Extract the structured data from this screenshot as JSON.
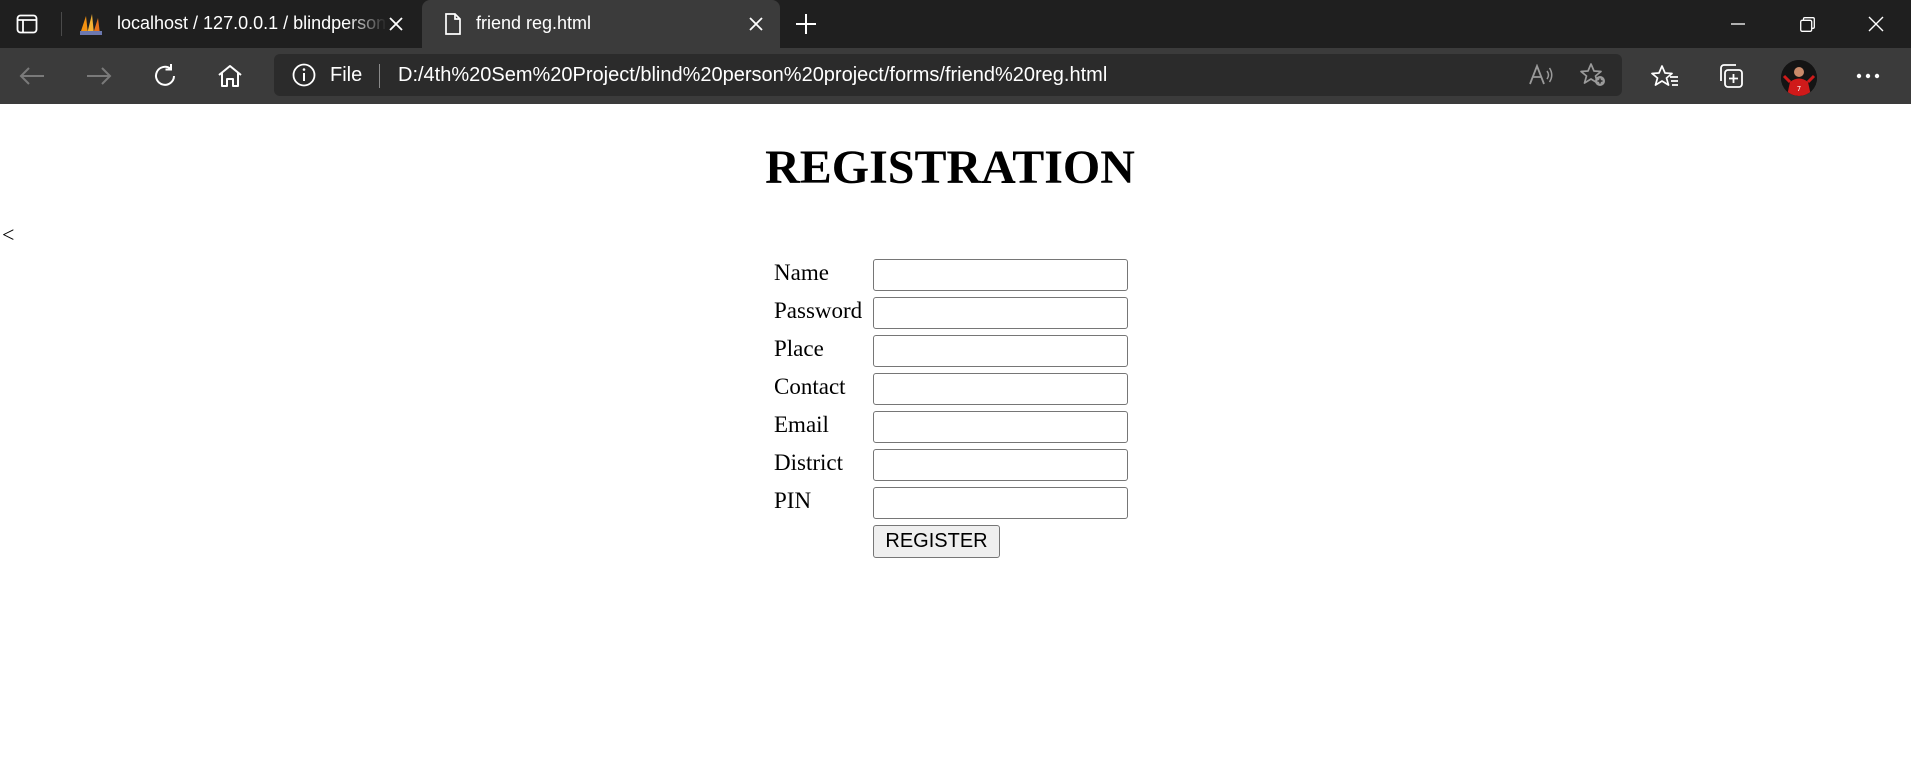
{
  "browser": {
    "tabs": [
      {
        "title": "localhost / 127.0.0.1 / blindperson",
        "favicon": "phpmyadmin-icon",
        "active": false
      },
      {
        "title": "friend reg.html",
        "favicon": "file-icon",
        "active": true
      }
    ],
    "address_bar": {
      "site_label": "File",
      "url": "D:/4th%20Sem%20Project/blind%20person%20project/forms/friend%20reg.html"
    },
    "colors": {
      "tabstrip": "#1f1f1f",
      "toolbar": "#3b3b3b",
      "omnibox": "#2b2b2b"
    }
  },
  "page": {
    "heading": "REGISTRATION",
    "stray_text": "<",
    "form": {
      "fields": [
        {
          "label": "Name",
          "value": ""
        },
        {
          "label": "Password",
          "value": ""
        },
        {
          "label": "Place",
          "value": ""
        },
        {
          "label": "Contact",
          "value": ""
        },
        {
          "label": "Email",
          "value": ""
        },
        {
          "label": "District",
          "value": ""
        },
        {
          "label": "PIN",
          "value": ""
        }
      ],
      "submit_label": "REGISTER"
    }
  }
}
